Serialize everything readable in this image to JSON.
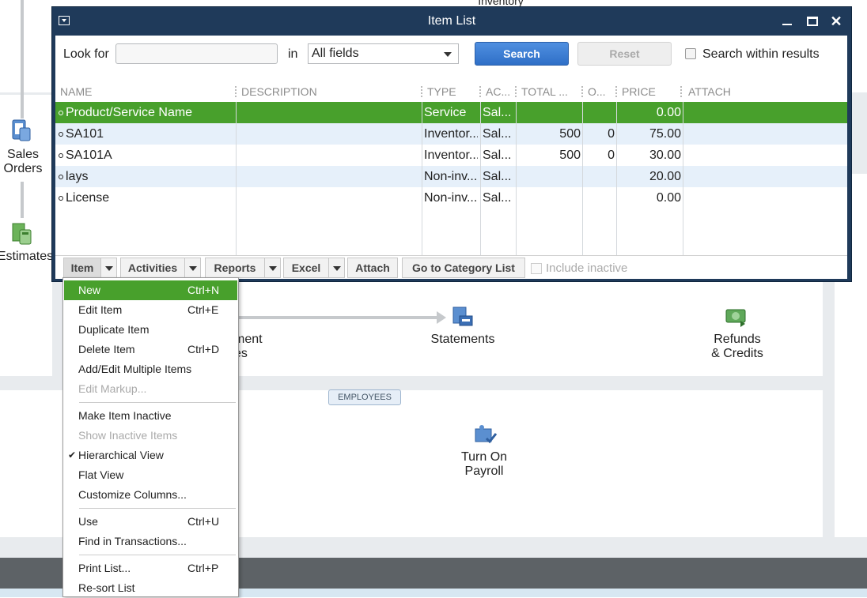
{
  "background": {
    "top_label_partial": "Inventory",
    "sales_orders": [
      "Sales",
      "Orders"
    ],
    "estimates": "Estimates",
    "partial_label": [
      "ment",
      "es"
    ],
    "statements": "Statements",
    "refunds": [
      "Refunds",
      "& Credits"
    ],
    "employees_badge": "EMPLOYEES",
    "payroll": [
      "Turn On",
      "Payroll"
    ]
  },
  "window": {
    "title": "Item List",
    "close_glyph": "✕"
  },
  "search": {
    "look_for_label": "Look for",
    "look_for_value": "",
    "in_label": "in",
    "field_value": "All fields",
    "search_button": "Search",
    "reset_button": "Reset",
    "search_within_label": "Search within results"
  },
  "table": {
    "columns": [
      "NAME",
      "DESCRIPTION",
      "TYPE",
      "AC...",
      "TOTAL ...",
      "O...",
      "PRICE",
      "ATTACH"
    ],
    "rows": [
      {
        "name": "Product/Service Name",
        "description": "",
        "type": "Service",
        "account": "Sal...",
        "total": "",
        "on_order": "",
        "price": "0.00",
        "attach": ""
      },
      {
        "name": "SA101",
        "description": "",
        "type": "Inventor...",
        "account": "Sal...",
        "total": "500",
        "on_order": "0",
        "price": "75.00",
        "attach": ""
      },
      {
        "name": "SA101A",
        "description": "",
        "type": "Inventor...",
        "account": "Sal...",
        "total": "500",
        "on_order": "0",
        "price": "30.00",
        "attach": ""
      },
      {
        "name": "lays",
        "description": "",
        "type": "Non-inv...",
        "account": "Sal...",
        "total": "",
        "on_order": "",
        "price": "20.00",
        "attach": ""
      },
      {
        "name": "License",
        "description": "",
        "type": "Non-inv...",
        "account": "Sal...",
        "total": "",
        "on_order": "",
        "price": "0.00",
        "attach": ""
      }
    ],
    "selected_row": 0
  },
  "toolbar": {
    "item": "Item",
    "activities": "Activities",
    "reports": "Reports",
    "excel": "Excel",
    "attach": "Attach",
    "category_list": "Go to Category List",
    "include_inactive": "Include inactive"
  },
  "menu": {
    "items": [
      {
        "label": "New",
        "shortcut": "Ctrl+N",
        "state": "highlighted"
      },
      {
        "label": "Edit Item",
        "shortcut": "Ctrl+E",
        "state": "normal"
      },
      {
        "label": "Duplicate Item",
        "shortcut": "",
        "state": "normal"
      },
      {
        "label": "Delete Item",
        "shortcut": "Ctrl+D",
        "state": "normal"
      },
      {
        "label": "Add/Edit Multiple Items",
        "shortcut": "",
        "state": "normal"
      },
      {
        "label": "Edit Markup...",
        "shortcut": "",
        "state": "disabled"
      },
      {
        "label": "Make Item Inactive",
        "shortcut": "",
        "state": "normal"
      },
      {
        "label": "Show Inactive Items",
        "shortcut": "",
        "state": "disabled"
      },
      {
        "label": "Hierarchical View",
        "shortcut": "",
        "state": "checked"
      },
      {
        "label": "Flat View",
        "shortcut": "",
        "state": "normal"
      },
      {
        "label": "Customize Columns...",
        "shortcut": "",
        "state": "normal"
      },
      {
        "label": "Use",
        "shortcut": "Ctrl+U",
        "state": "normal"
      },
      {
        "label": "Find in Transactions...",
        "shortcut": "",
        "state": "normal"
      },
      {
        "label": "Print List...",
        "shortcut": "Ctrl+P",
        "state": "normal"
      },
      {
        "label": "Re-sort List",
        "shortcut": "",
        "state": "normal"
      }
    ]
  },
  "colors": {
    "title_bar": "#1f3a5a",
    "selection_green": "#48a02c",
    "search_button": "#2f6fc7",
    "alt_row": "#e6f0fa"
  }
}
